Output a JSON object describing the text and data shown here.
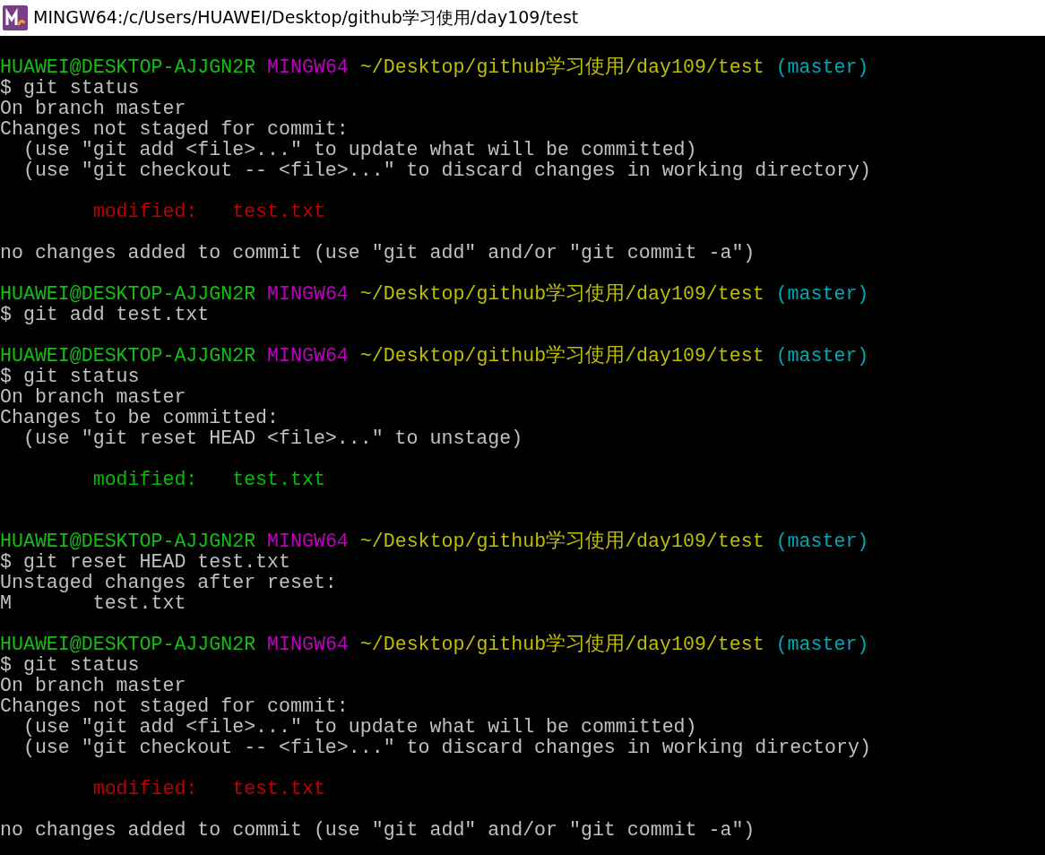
{
  "window": {
    "title": "MINGW64:/c/Users/HUAWEI/Desktop/github学习使用/day109/test"
  },
  "lines": [
    {
      "kind": "blank"
    },
    {
      "kind": "prompt",
      "user": "HUAWEI@DESKTOP-AJJGN2R",
      "system": "MINGW64",
      "path": "~/Desktop/github学习使用/day109/test",
      "branch": "(master)"
    },
    {
      "kind": "text",
      "text": "$ git status"
    },
    {
      "kind": "text",
      "text": "On branch master"
    },
    {
      "kind": "text",
      "text": "Changes not staged for commit:"
    },
    {
      "kind": "text",
      "text": "  (use \"git add <file>...\" to update what will be committed)"
    },
    {
      "kind": "text",
      "text": "  (use \"git checkout -- <file>...\" to discard changes in working directory)"
    },
    {
      "kind": "blank"
    },
    {
      "kind": "unstaged",
      "text": "        modified:   test.txt"
    },
    {
      "kind": "blank"
    },
    {
      "kind": "text",
      "text": "no changes added to commit (use \"git add\" and/or \"git commit -a\")"
    },
    {
      "kind": "blank"
    },
    {
      "kind": "prompt",
      "user": "HUAWEI@DESKTOP-AJJGN2R",
      "system": "MINGW64",
      "path": "~/Desktop/github学习使用/day109/test",
      "branch": "(master)"
    },
    {
      "kind": "text",
      "text": "$ git add test.txt"
    },
    {
      "kind": "blank"
    },
    {
      "kind": "prompt",
      "user": "HUAWEI@DESKTOP-AJJGN2R",
      "system": "MINGW64",
      "path": "~/Desktop/github学习使用/day109/test",
      "branch": "(master)"
    },
    {
      "kind": "text",
      "text": "$ git status"
    },
    {
      "kind": "text",
      "text": "On branch master"
    },
    {
      "kind": "text",
      "text": "Changes to be committed:"
    },
    {
      "kind": "text",
      "text": "  (use \"git reset HEAD <file>...\" to unstage)"
    },
    {
      "kind": "blank"
    },
    {
      "kind": "staged",
      "text": "        modified:   test.txt"
    },
    {
      "kind": "blank"
    },
    {
      "kind": "blank"
    },
    {
      "kind": "prompt",
      "user": "HUAWEI@DESKTOP-AJJGN2R",
      "system": "MINGW64",
      "path": "~/Desktop/github学习使用/day109/test",
      "branch": "(master)"
    },
    {
      "kind": "text",
      "text": "$ git reset HEAD test.txt"
    },
    {
      "kind": "text",
      "text": "Unstaged changes after reset:"
    },
    {
      "kind": "text",
      "text": "M       test.txt"
    },
    {
      "kind": "blank"
    },
    {
      "kind": "prompt",
      "user": "HUAWEI@DESKTOP-AJJGN2R",
      "system": "MINGW64",
      "path": "~/Desktop/github学习使用/day109/test",
      "branch": "(master)"
    },
    {
      "kind": "text",
      "text": "$ git status"
    },
    {
      "kind": "text",
      "text": "On branch master"
    },
    {
      "kind": "text",
      "text": "Changes not staged for commit:"
    },
    {
      "kind": "text",
      "text": "  (use \"git add <file>...\" to update what will be committed)"
    },
    {
      "kind": "text",
      "text": "  (use \"git checkout -- <file>...\" to discard changes in working directory)"
    },
    {
      "kind": "blank"
    },
    {
      "kind": "unstaged",
      "text": "        modified:   test.txt"
    },
    {
      "kind": "blank"
    },
    {
      "kind": "text",
      "text": "no changes added to commit (use \"git add\" and/or \"git commit -a\")"
    }
  ]
}
